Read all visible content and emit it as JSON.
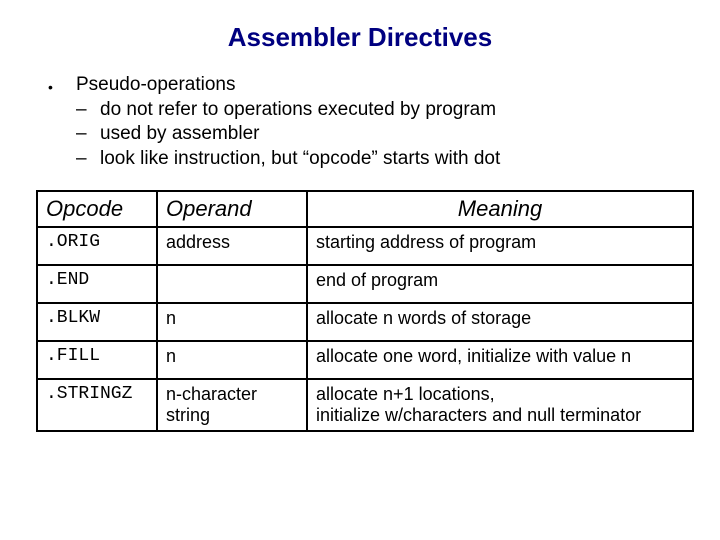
{
  "title": "Assembler Directives",
  "bullets": {
    "main": "Pseudo-operations",
    "subs": [
      "do not refer to operations executed by program",
      "used by assembler",
      "look like instruction, but “opcode” starts with dot"
    ]
  },
  "table": {
    "headers": [
      "Opcode",
      "Operand",
      "Meaning"
    ],
    "rows": [
      {
        "opcode": ".ORIG",
        "operand": "address",
        "meaning": "starting address of program"
      },
      {
        "opcode": ".END",
        "operand": "",
        "meaning": "end of program"
      },
      {
        "opcode": ".BLKW",
        "operand": "n",
        "meaning": "allocate n words of storage"
      },
      {
        "opcode": ".FILL",
        "operand": "n",
        "meaning": "allocate one word, initialize with value n"
      },
      {
        "opcode": ".STRINGZ",
        "operand": "n-character string",
        "meaning": "allocate n+1 locations,\ninitialize w/characters and null terminator"
      }
    ]
  }
}
